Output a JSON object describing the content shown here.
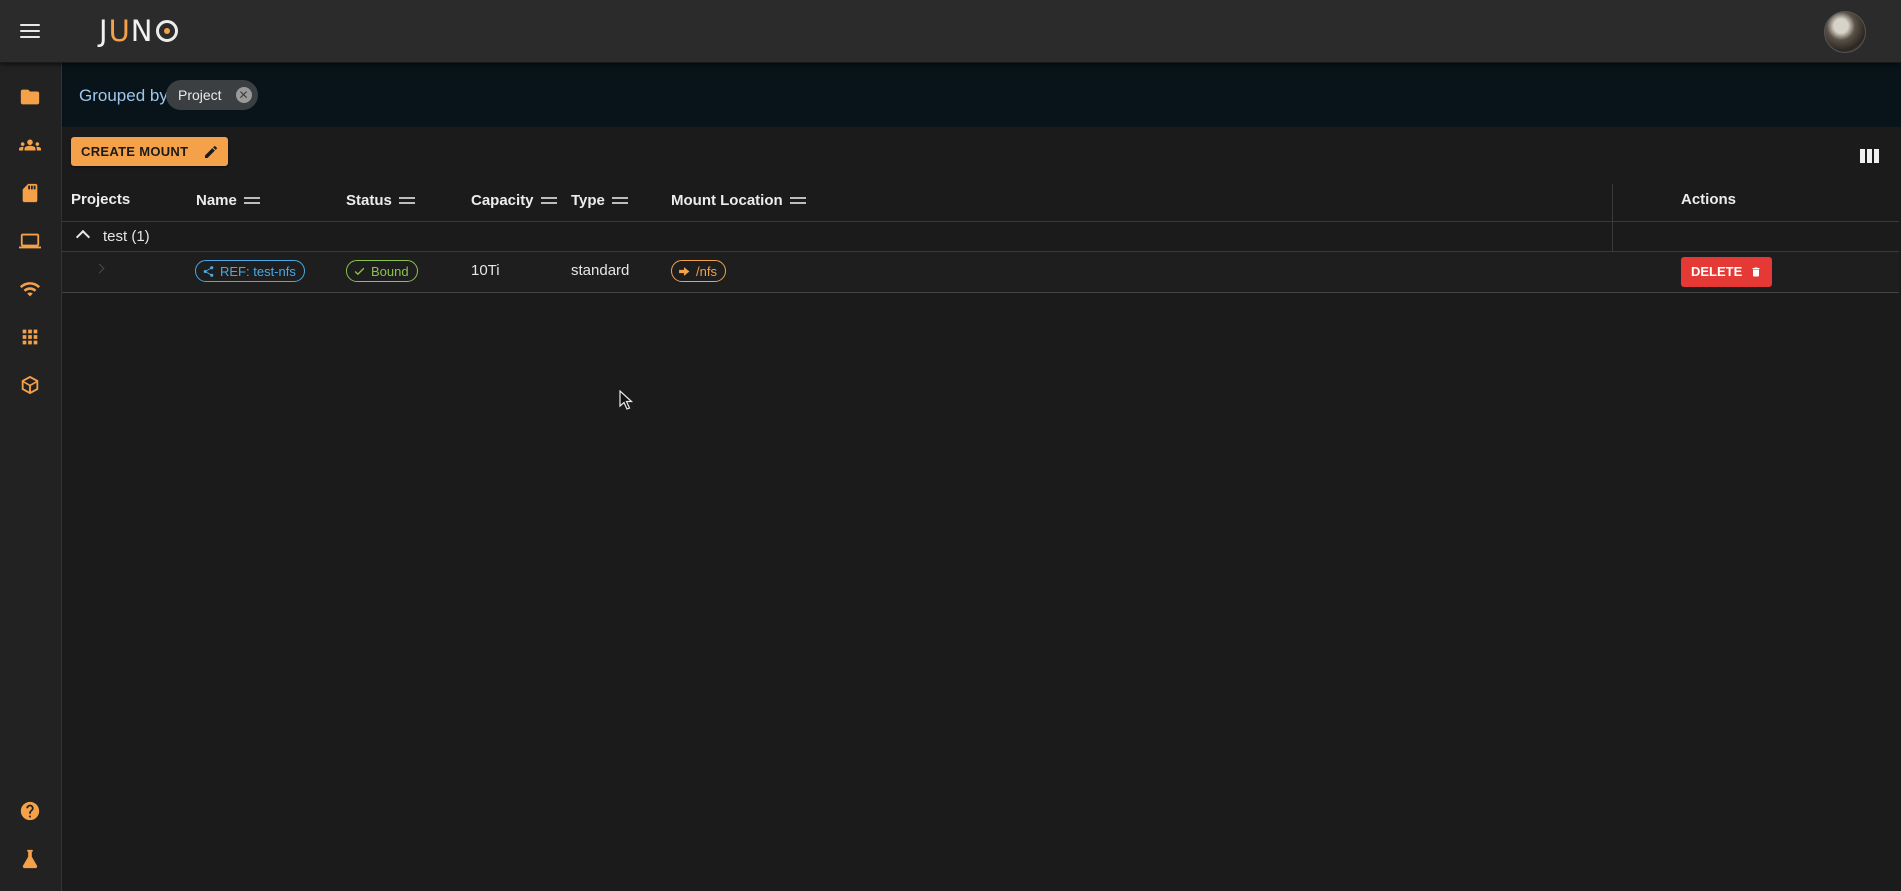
{
  "app": {
    "logo_text": "JUNO",
    "logo_prefix": "J",
    "logo_mid": "U",
    "logo_n": "N"
  },
  "rail": {
    "items": [
      {
        "icon": "folder-icon"
      },
      {
        "icon": "users-icon"
      },
      {
        "icon": "sd-card-icon"
      },
      {
        "icon": "laptop-icon"
      },
      {
        "icon": "wifi-icon"
      },
      {
        "icon": "apps-grid-icon"
      },
      {
        "icon": "package-icon"
      }
    ],
    "bottom": [
      {
        "icon": "help-icon"
      },
      {
        "icon": "flask-icon"
      }
    ]
  },
  "groupbar": {
    "label": "Grouped by",
    "chip": "Project"
  },
  "toolbar": {
    "create_label": "CREATE MOUNT"
  },
  "table": {
    "headers": {
      "projects": "Projects",
      "name": "Name",
      "status": "Status",
      "capacity": "Capacity",
      "type": "Type",
      "mount_location": "Mount Location",
      "actions": "Actions"
    },
    "group": {
      "label": "test (1)"
    },
    "row": {
      "name": "REF: test-nfs",
      "status": "Bound",
      "capacity": "10Ti",
      "type": "standard",
      "mount_location": "/nfs",
      "delete_label": "DELETE"
    }
  },
  "colors": {
    "accent": "#f4a14a",
    "link": "#48a9e6",
    "success": "#8bc34a",
    "danger": "#e53935"
  }
}
